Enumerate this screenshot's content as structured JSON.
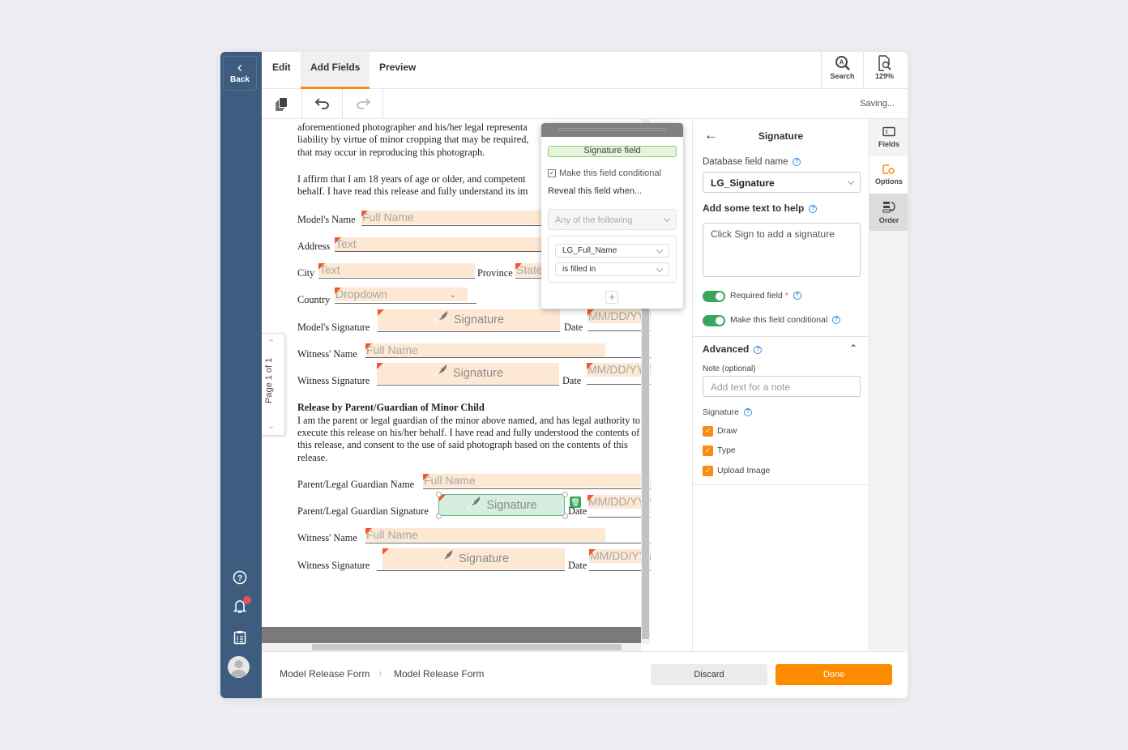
{
  "sidebar": {
    "back_label": "Back",
    "icons": [
      "help-icon",
      "bell-icon",
      "clipboard-icon",
      "avatar"
    ],
    "notification_dot": true
  },
  "tabs": [
    {
      "label": "Edit",
      "active": false
    },
    {
      "label": "Add Fields",
      "active": true
    },
    {
      "label": "Preview",
      "active": false
    }
  ],
  "top_tools": {
    "search_label": "Search",
    "zoom_label": "129%"
  },
  "toolbar": {
    "buttons": [
      "copy-icon",
      "undo-icon",
      "redo-icon"
    ],
    "status": "Saving..."
  },
  "document": {
    "para1": [
      "aforementioned photographer and his/her legal representa",
      "liability by virtue of minor cropping that may be required,",
      "that may occur in reproducing this photograph."
    ],
    "para2": [
      "I affirm that I am 18 years of age or older, and competent",
      "behalf. I have read this release and fully understand its im"
    ],
    "labels": {
      "model_name": "Model's Name",
      "address": "Address",
      "city": "City",
      "province": "Province",
      "country": "Country",
      "model_signature": "Model's Signature",
      "date": "Date",
      "witness_name": "Witness' Name",
      "witness_signature": "Witness Signature",
      "guardian_name": "Parent/Legal Guardian Name",
      "guardian_signature": "Parent/Legal Guardian Signature"
    },
    "section_heading": "Release by Parent/Guardian of Minor Child",
    "para3": [
      "I am the parent or legal guardian of the minor above named, and has legal authority to",
      "execute this release on his/her behalf. I have read and fully understood the contents of",
      "this release, and consent to the use of said photograph based on the contents of this",
      "release."
    ],
    "placeholders": {
      "full_name": "Full Name",
      "text": "Text",
      "state": "State",
      "dropdown": "Dropdown",
      "signature": "Signature",
      "date": "MM/DD/YYYY"
    }
  },
  "pager": {
    "label": "Page 1 of 1"
  },
  "popover": {
    "field_type": "Signature field",
    "conditional_label": "Make this field conditional",
    "conditional_checked": true,
    "reveal_label": "Reveal this field when...",
    "match_mode": "Any of the following",
    "condition_field": "LG_Full_Name",
    "condition_operator": "is filled in",
    "add_label": "+"
  },
  "properties": {
    "title": "Signature",
    "db_field_label": "Database field name",
    "db_field_value": "LG_Signature",
    "help_label": "Add some text to help",
    "help_value": "Click Sign to add a signature",
    "required_label": "Required field",
    "required_on": true,
    "conditional_label": "Make this field conditional",
    "conditional_on": true,
    "advanced_label": "Advanced",
    "note_label": "Note (optional)",
    "note_placeholder": "Add text for a note",
    "signature_label": "Signature",
    "signature_options": [
      {
        "label": "Draw",
        "checked": true
      },
      {
        "label": "Type",
        "checked": true
      },
      {
        "label": "Upload Image",
        "checked": true
      }
    ]
  },
  "rail": [
    {
      "label": "Fields"
    },
    {
      "label": "Options"
    },
    {
      "label": "Order"
    }
  ],
  "footer": {
    "breadcrumb": [
      "Model Release Form",
      "Model Release Form"
    ],
    "discard_label": "Discard",
    "done_label": "Done"
  },
  "colors": {
    "sidebar": "#3e5c7f",
    "accent": "#fb8c00",
    "toggle_on": "#3aa65b",
    "field_bg": "#fde9d3",
    "field_marker": "#f2582a"
  }
}
